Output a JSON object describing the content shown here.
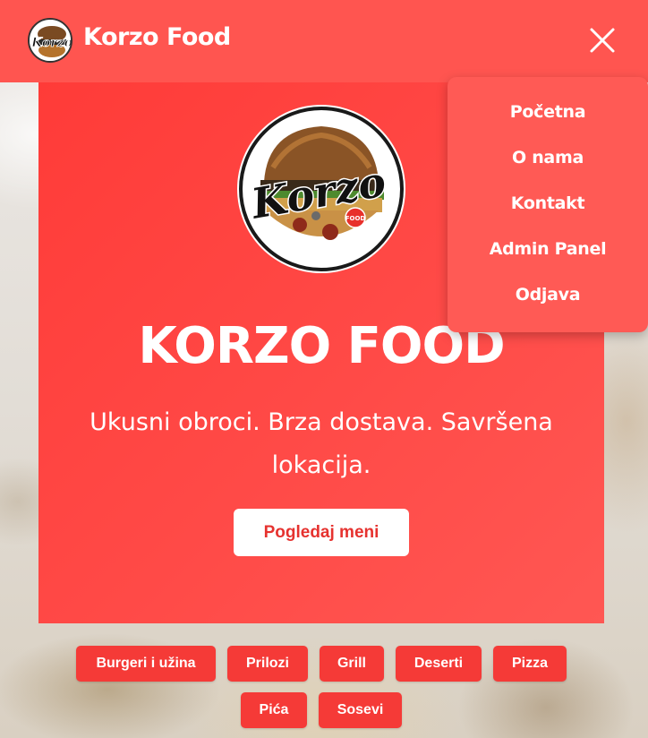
{
  "header": {
    "brand_name": "Korzo Food",
    "logo_icon": "korzo-burger-logo",
    "close_icon": "close-x-icon"
  },
  "hero": {
    "logo_text": "Korzo",
    "logo_badge_text": "FOOD",
    "title": "KORZO FOOD",
    "subtitle": "Ukusni obroci. Brza dostava. Savršena lokacija.",
    "cta_label": "Pogledaj meni"
  },
  "menu": {
    "items": [
      {
        "label": "Početna"
      },
      {
        "label": "O nama"
      },
      {
        "label": "Kontakt"
      },
      {
        "label": "Admin Panel"
      },
      {
        "label": "Odjava"
      }
    ]
  },
  "categories": [
    {
      "label": "Burgeri i užina"
    },
    {
      "label": "Prilozi"
    },
    {
      "label": "Grill"
    },
    {
      "label": "Deserti"
    },
    {
      "label": "Pizza"
    },
    {
      "label": "Pića"
    },
    {
      "label": "Sosevi"
    }
  ],
  "colors": {
    "brand_red": "#ff5550",
    "hero_red": "#ff4542",
    "pill_red": "#f53a37",
    "cta_text": "#e6322f"
  }
}
